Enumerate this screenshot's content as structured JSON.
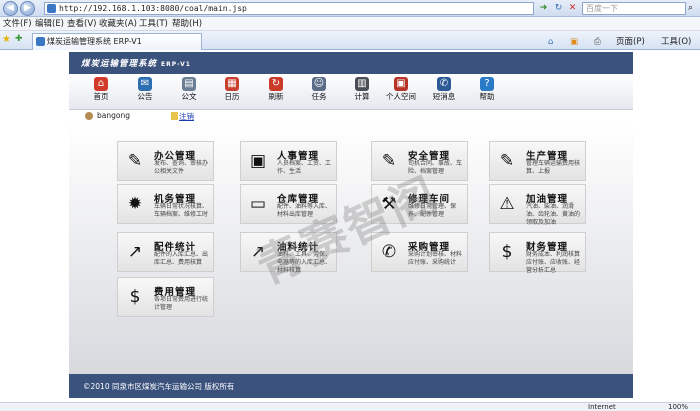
{
  "browser": {
    "url": "http://192.168.1.103:8080/coal/main.jsp",
    "search_placeholder": "百度一下",
    "menu": [
      "文件(F)",
      "编辑(E)",
      "查看(V)",
      "收藏夹(A)",
      "工具(T)",
      "帮助(H)"
    ],
    "tab_title": "煤炭运输管理系统 ERP-V1",
    "cmd": {
      "page": "页面(P)",
      "tools": "工具(O)"
    },
    "status": {
      "zone": "Internet",
      "zoom": "100%"
    }
  },
  "app": {
    "title": "煤炭运输管理系统",
    "version": "ERP-V1",
    "toolbar": [
      {
        "label": "首页",
        "icon": "home-icon",
        "color": "#d23b2b",
        "glyph": "⌂"
      },
      {
        "label": "公告",
        "icon": "megaphone-icon",
        "color": "#2d6fb0",
        "glyph": "✉"
      },
      {
        "label": "公文",
        "icon": "folder-icon",
        "color": "#6a7f95",
        "glyph": "▤"
      },
      {
        "label": "日历",
        "icon": "calendar-icon",
        "color": "#c8402e",
        "glyph": "▦"
      },
      {
        "label": "刷新",
        "icon": "refresh-icon",
        "color": "#cc3a2a",
        "glyph": "↻"
      },
      {
        "label": "任务",
        "icon": "users-icon",
        "color": "#5b6d86",
        "glyph": "☺"
      },
      {
        "label": "计算",
        "icon": "calculator-icon",
        "color": "#4a4f57",
        "glyph": "▥"
      },
      {
        "label": "个人空间",
        "icon": "lock-icon",
        "color": "#b63428",
        "glyph": "▣"
      },
      {
        "label": "短消息",
        "icon": "message-icon",
        "color": "#2b5a96",
        "glyph": "✆"
      },
      {
        "label": "帮助",
        "icon": "help-icon",
        "color": "#2b7ac6",
        "glyph": "?"
      }
    ],
    "user": {
      "name": "bangong",
      "logout": "注销"
    },
    "cards": [
      {
        "title": "办公管理",
        "desc": "发布、查询、审核办公相关文件",
        "icon": "edit-icon",
        "glyph": "✎"
      },
      {
        "title": "人事管理",
        "desc": "人员档案、工资、工作、生活",
        "icon": "id-card-icon",
        "glyph": "▣"
      },
      {
        "title": "安全管理",
        "desc": "司机合同、事故、车险、档案管理",
        "icon": "edit-icon",
        "glyph": "✎"
      },
      {
        "title": "生产管理",
        "desc": "管理车辆运输费用核算、上报",
        "icon": "edit-icon",
        "glyph": "✎"
      },
      {
        "title": "机务管理",
        "desc": "车辆日常状况核算、车辆档案、维修工时",
        "icon": "gear-icon",
        "glyph": "✹"
      },
      {
        "title": "仓库管理",
        "desc": "配件、油料等入库、材料出库管理",
        "icon": "monitor-icon",
        "glyph": "▭"
      },
      {
        "title": "修理车间",
        "desc": "维修日常管理、保养、配件管理",
        "icon": "wrench-icon",
        "glyph": "⚒"
      },
      {
        "title": "加油管理",
        "desc": "汽油、柴油、润滑油、齿轮油、黄油的领取及加油",
        "icon": "warning-icon",
        "glyph": "⚠"
      },
      {
        "title": "配件统计",
        "desc": "配件的入库汇总、出库汇总、费用核算",
        "icon": "chart-icon",
        "glyph": "↗"
      },
      {
        "title": "油料统计",
        "desc": "油料、工具、劳保、电器等的入库汇总、材料核算",
        "icon": "chart-icon",
        "glyph": "↗"
      },
      {
        "title": "采购管理",
        "desc": "采购计划审核、材料应付账、采购统计",
        "icon": "phone-icon",
        "glyph": "✆"
      },
      {
        "title": "财务管理",
        "desc": "财务成本、利润核算应付账、应收账、经营分析汇总",
        "icon": "money-icon",
        "glyph": "$"
      },
      {
        "title": "费用管理",
        "desc": "各项日常费用进行统计管理",
        "icon": "money-icon",
        "glyph": "$"
      }
    ],
    "watermark": "青赛智阁",
    "footer": "©2010   同泉市区煤炭汽车运输公司   版权所有"
  }
}
